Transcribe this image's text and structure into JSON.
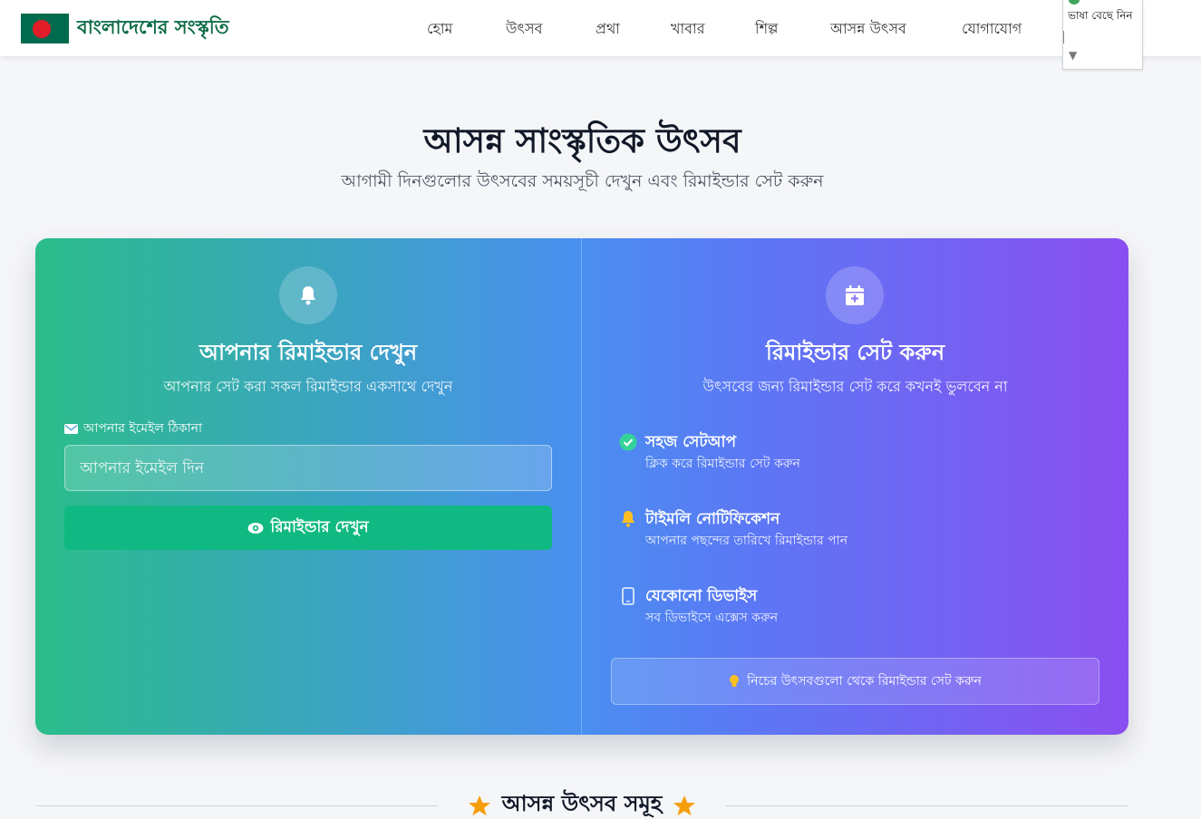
{
  "header": {
    "logo_text": "বাংলাদেশের সংস্কৃতি",
    "nav": [
      "হোম",
      "উৎসব",
      "প্রথা",
      "খাবার",
      "শিল্প",
      "আসন্ন উৎসব",
      "যোগাযোগ"
    ],
    "language_label": "ভাষা বেছে নিন"
  },
  "hero": {
    "title": "আসন্ন সাংস্কৃতিক উৎসব",
    "subtitle": "আগামী দিনগুলোর উৎসবের সময়সূচী দেখুন এবং রিমাইন্ডার সেট করুন"
  },
  "left_panel": {
    "icon": "bell-icon",
    "title": "আপনার রিমাইন্ডার দেখুন",
    "subtitle": "আপনার সেট করা সকল রিমাইন্ডার একসাথে দেখুন",
    "email_label": "আপনার ইমেইল ঠিকানা",
    "email_placeholder": "আপনার ইমেইল দিন",
    "email_value": "",
    "button_label": "রিমাইন্ডার দেখুন"
  },
  "right_panel": {
    "icon": "calendar-plus-icon",
    "title": "রিমাইন্ডার সেট করুন",
    "subtitle": "উৎসবের জন্য রিমাইন্ডার সেট করে কখনই ভুলবেন না",
    "features": [
      {
        "icon": "check-circle-icon",
        "title": "সহজ সেটআপ",
        "desc": "ক্লিক করে রিমাইন্ডার সেট করুন"
      },
      {
        "icon": "bell-icon",
        "title": "টাইমলি নোটিফিকেশন",
        "desc": "আপনার পছন্দের তারিখে রিমাইন্ডার পান"
      },
      {
        "icon": "mobile-icon",
        "title": "যেকোনো ডিভাইস",
        "desc": "সব ডিভাইসে এক্সেস করুন"
      }
    ],
    "tip": "নিচের উৎসবগুলো থেকে রিমাইন্ডার সেট করুন"
  },
  "upcoming": {
    "title": "আসন্ন উৎসব সমূহ"
  },
  "colors": {
    "brand_green": "#0b6b45",
    "button_green": "#10b981",
    "gradient_start": "#2bbd8a",
    "gradient_end": "#8a4ef0",
    "star": "#f59e0b"
  }
}
